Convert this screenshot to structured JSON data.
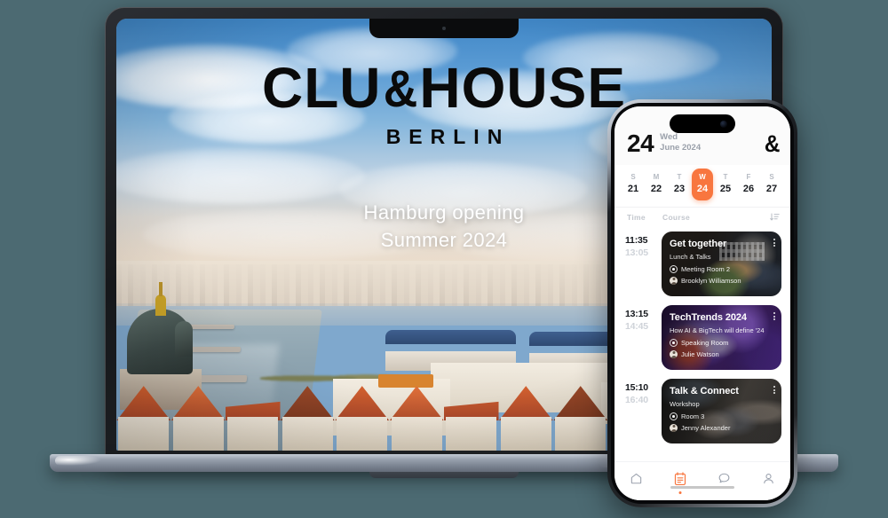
{
  "background": {
    "color": "#4c6a72"
  },
  "accent": {
    "orange": "#f8763f",
    "ink": "#0a0a0a"
  },
  "laptop": {
    "hero": {
      "wordmark_part1": "CLU",
      "wordmark_amp": "&",
      "wordmark_part2": "HOUSE",
      "subtitle": "BERLIN",
      "tagline_line1": "Hamburg opening",
      "tagline_line2": "Summer 2024"
    },
    "photo_alt": "Berlin cityscape with Berliner Dom, river Spree and Fernsehturm"
  },
  "phone": {
    "header": {
      "day_number": "24",
      "weekday": "Wed",
      "month_year": "June 2024",
      "logo": "&"
    },
    "week": [
      {
        "dow": "S",
        "num": "21",
        "active": false
      },
      {
        "dow": "M",
        "num": "22",
        "active": false
      },
      {
        "dow": "T",
        "num": "23",
        "active": false
      },
      {
        "dow": "W",
        "num": "24",
        "active": true
      },
      {
        "dow": "T",
        "num": "25",
        "active": false
      },
      {
        "dow": "F",
        "num": "26",
        "active": false
      },
      {
        "dow": "S",
        "num": "27",
        "active": false
      }
    ],
    "list_header": {
      "time": "Time",
      "course": "Course",
      "sort_icon": "sort-descending-icon"
    },
    "events": [
      {
        "start": "11:35",
        "end": "13:05",
        "title": "Get together",
        "subtitle": "Lunch & Talks",
        "room": "Meeting Room 2",
        "host": "Brooklyn Williamson",
        "theme": "bg-get"
      },
      {
        "start": "13:15",
        "end": "14:45",
        "title": "TechTrends 2024",
        "subtitle": "How AI & BigTech will define '24",
        "room": "Speaking Room",
        "host": "Julie Watson",
        "theme": "bg-tech"
      },
      {
        "start": "15:10",
        "end": "16:40",
        "title": "Talk & Connect",
        "subtitle": "Workshop",
        "room": "Room 3",
        "host": "Jenny Alexander",
        "theme": "bg-talk"
      }
    ],
    "nav": [
      {
        "name": "home-icon",
        "active": false
      },
      {
        "name": "schedule-icon",
        "active": true
      },
      {
        "name": "chat-icon",
        "active": false
      },
      {
        "name": "profile-icon",
        "active": false
      }
    ]
  }
}
